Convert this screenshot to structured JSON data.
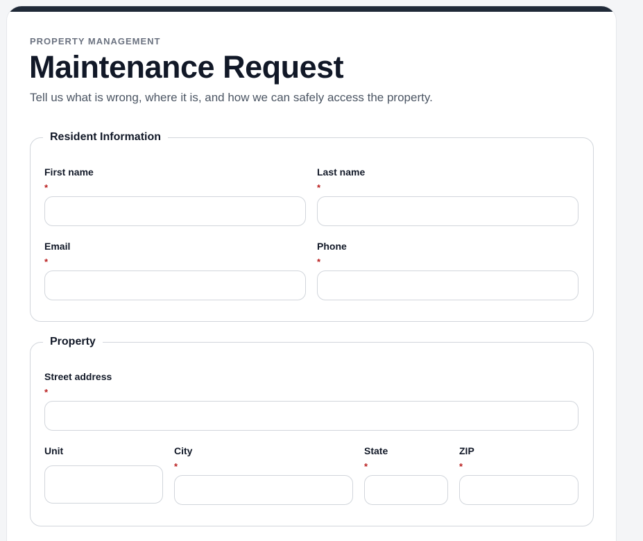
{
  "header": {
    "eyebrow": "PROPERTY MANAGEMENT",
    "title": "Maintenance Request",
    "subtitle": "Tell us what is wrong, where it is, and how we can safely access the property."
  },
  "resident": {
    "legend": "Resident Information",
    "first_name": {
      "label": "First name",
      "required": "*",
      "value": ""
    },
    "last_name": {
      "label": "Last name",
      "required": "*",
      "value": ""
    },
    "email": {
      "label": "Email",
      "required": "*",
      "value": ""
    },
    "phone": {
      "label": "Phone",
      "required": "*",
      "value": ""
    }
  },
  "property": {
    "legend": "Property",
    "street": {
      "label": "Street address",
      "required": "*",
      "value": ""
    },
    "unit": {
      "label": "Unit",
      "value": ""
    },
    "city": {
      "label": "City",
      "required": "*",
      "value": ""
    },
    "state": {
      "label": "State",
      "required": "*",
      "value": ""
    },
    "zip": {
      "label": "ZIP",
      "required": "*",
      "value": ""
    }
  },
  "colors": {
    "accent_bar": "#1f2937",
    "required_marker": "#b91c1c",
    "border": "#d1d5db"
  }
}
